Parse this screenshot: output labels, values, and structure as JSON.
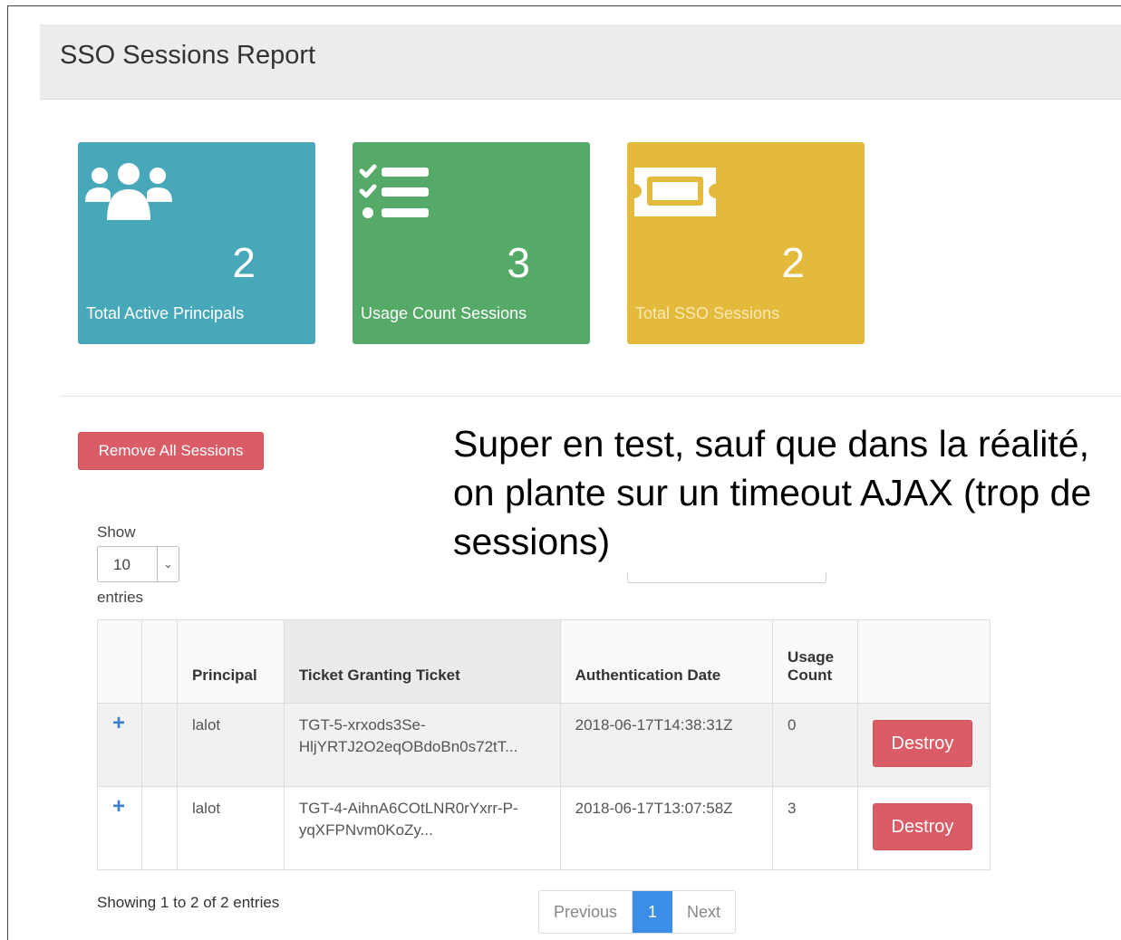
{
  "header": {
    "title": "SSO Sessions Report"
  },
  "tiles": [
    {
      "icon": "users-icon",
      "value": "2",
      "label": "Total Active Principals",
      "color": "#47a8b9"
    },
    {
      "icon": "checklist-icon",
      "value": "3",
      "label": "Usage Count Sessions",
      "color": "#56aa67"
    },
    {
      "icon": "ticket-icon",
      "value": "2",
      "label": "Total SSO Sessions",
      "color": "#e3ba3c"
    }
  ],
  "actions": {
    "remove_all_label": "Remove All Sessions"
  },
  "note": "Super en test, sauf que dans la réalité, on plante sur un timeout AJAX (trop de sessions)",
  "length": {
    "show_label": "Show",
    "selected": "10",
    "entries_label": "entries"
  },
  "table": {
    "headers": [
      "",
      "",
      "Principal",
      "Ticket Granting Ticket",
      "Authentication Date",
      "Usage Count",
      ""
    ],
    "rows": [
      {
        "expand": "+",
        "principal": "lalot",
        "tgt": "TGT-5-xrxods3Se-HljYRTJ2O2eqOBdoBn0s72tT...",
        "auth_date": "2018-06-17T14:38:31Z",
        "usage": "0",
        "action": "Destroy"
      },
      {
        "expand": "+",
        "principal": "lalot",
        "tgt": "TGT-4-AihnA6COtLNR0rYxrr-P-yqXFPNvm0KoZy...",
        "auth_date": "2018-06-17T13:07:58Z",
        "usage": "3",
        "action": "Destroy"
      }
    ]
  },
  "footer": {
    "info": "Showing 1 to 2 of 2 entries"
  },
  "pagination": {
    "previous": "Previous",
    "current": "1",
    "next": "Next"
  }
}
